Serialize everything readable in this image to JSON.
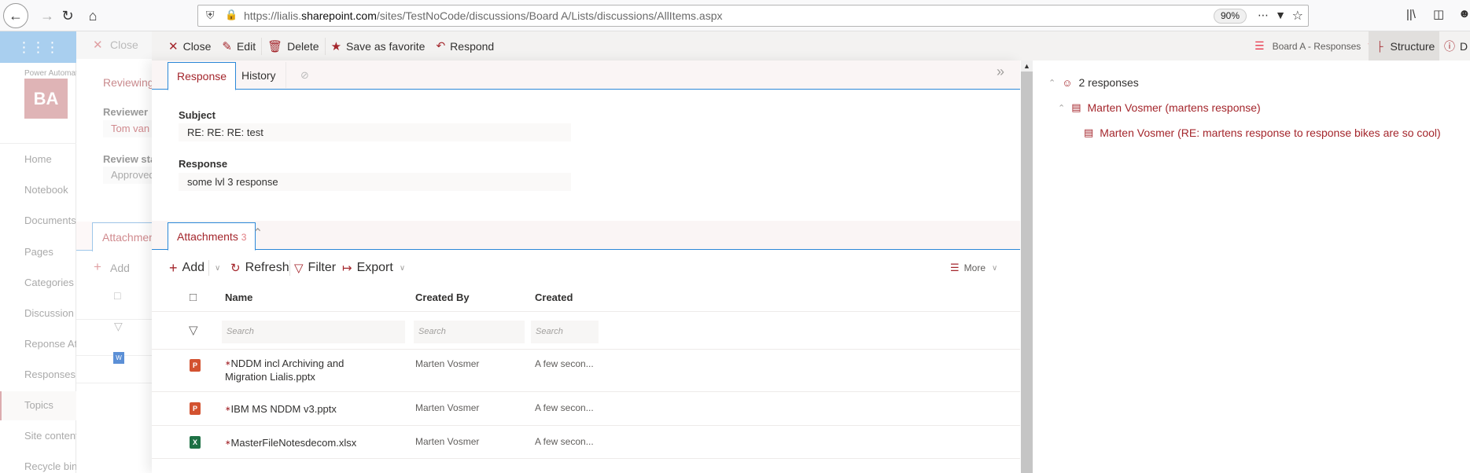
{
  "browser": {
    "url_prefix": "https://lialis.",
    "url_domain": "sharepoint.com",
    "url_path": "/sites/TestNoCode/discussions/Board A/Lists/discussions/AllItems.aspx",
    "zoom": "90%"
  },
  "site": {
    "logo_initials": "BA",
    "site_title": "Power Automate",
    "nav": [
      "Home",
      "Notebook",
      "Documents",
      "Pages",
      "Categories",
      "Discussion ...",
      "Reponse At...",
      "Responses",
      "Topics",
      "Site contents",
      "Recycle bin"
    ],
    "active_nav": "Topics"
  },
  "background_panel": {
    "close_label": "Close",
    "section_title": "Reviewing",
    "reviewer_label": "Reviewer",
    "reviewer_value": "Tom van",
    "status_label": "Review status",
    "status_value": "Approved",
    "attachments_tab": "Attachments",
    "add_label": "Add"
  },
  "toolbar": {
    "close_label": "Close",
    "edit_label": "Edit",
    "delete_label": "Delete",
    "favorite_label": "Save as favorite",
    "respond_label": "Respond",
    "view_selector": "Board A - Responses",
    "structure_label": "Structure",
    "details_label": "D"
  },
  "tabs": {
    "response": "Response",
    "history": "History"
  },
  "form": {
    "subject_label": "Subject",
    "subject_value": "RE: RE: RE: test",
    "response_label": "Response",
    "response_value": "some lvl 3 response"
  },
  "attachments": {
    "tab_label": "Attachments",
    "count": "3",
    "add_label": "Add",
    "refresh_label": "Refresh",
    "filter_label": "Filter",
    "export_label": "Export",
    "more_label": "More",
    "columns": [
      "Name",
      "Created By",
      "Created"
    ],
    "search_placeholder": "Search",
    "rows": [
      {
        "type": "pptx",
        "name": "NDDM incl Archiving and Migration Lialis.pptx",
        "created_by": "Marten Vosmer",
        "created": "A few secon..."
      },
      {
        "type": "pptx",
        "name": "IBM MS NDDM v3.pptx",
        "created_by": "Marten Vosmer",
        "created": "A few secon..."
      },
      {
        "type": "xlsx",
        "name": "MasterFileNotesdecom.xlsx",
        "created_by": "Marten Vosmer",
        "created": "A few secon..."
      }
    ]
  },
  "structure": {
    "root": "2 responses",
    "items": [
      "Marten Vosmer (martens response)",
      "Marten Vosmer (RE: martens response to response bikes are so cool)"
    ]
  },
  "colors": {
    "accent": "#a4262c",
    "tab_border": "#2b88d8"
  }
}
